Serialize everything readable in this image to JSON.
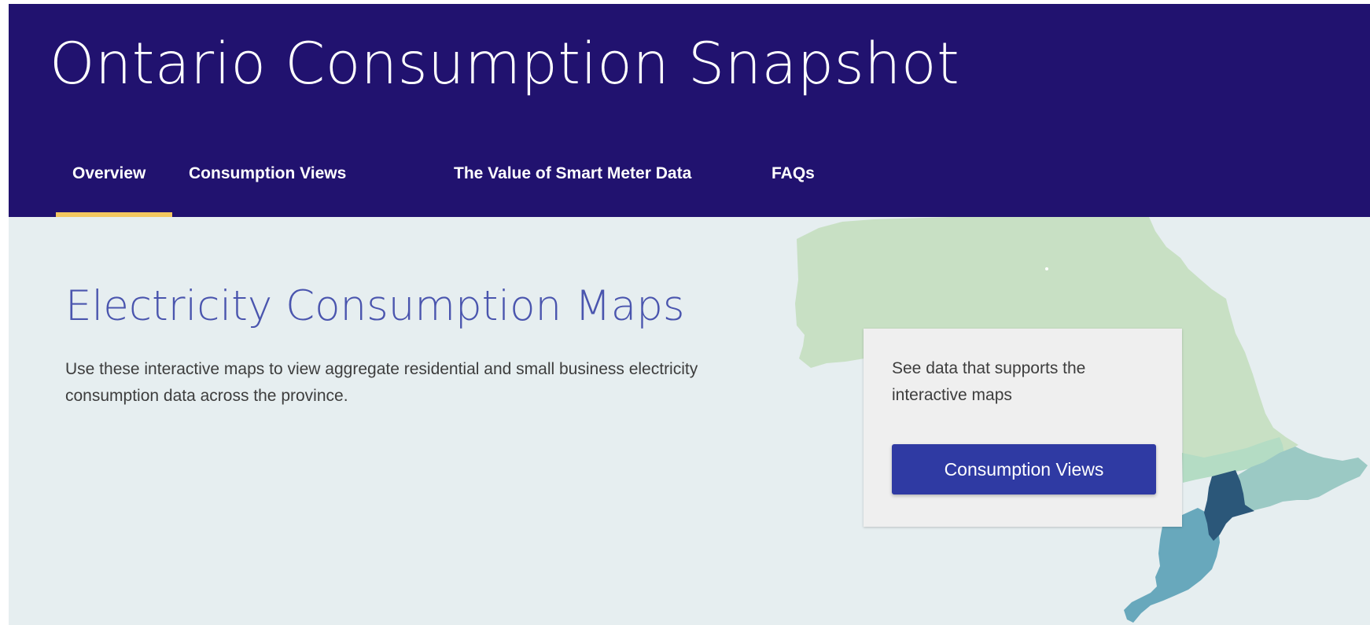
{
  "header": {
    "title": "Ontario Consumption Snapshot",
    "nav": [
      {
        "label": "Overview",
        "active": true
      },
      {
        "label": "Consumption Views",
        "active": false
      },
      {
        "label": "The Value of Smart Meter Data",
        "active": false
      },
      {
        "label": "FAQs",
        "active": false
      }
    ]
  },
  "main": {
    "heading": "Electricity Consumption Maps",
    "description": "Use these interactive maps to view aggregate residential and small business electricity consumption data across the province."
  },
  "card": {
    "text": "See data that supports the interactive maps",
    "button_label": "Consumption Views"
  },
  "colors": {
    "header_bg": "#21126f",
    "active_tab_underline": "#f3c75f",
    "main_bg": "#e6eef0",
    "heading": "#4a55ae",
    "button_bg": "#2f3aa3",
    "map_region_light": "#c8e0c4",
    "map_region_mid": "#b4dcc4",
    "map_region_teal": "#9bc9c4",
    "map_region_blue": "#68a8bc",
    "map_region_dark": "#2b5779"
  }
}
